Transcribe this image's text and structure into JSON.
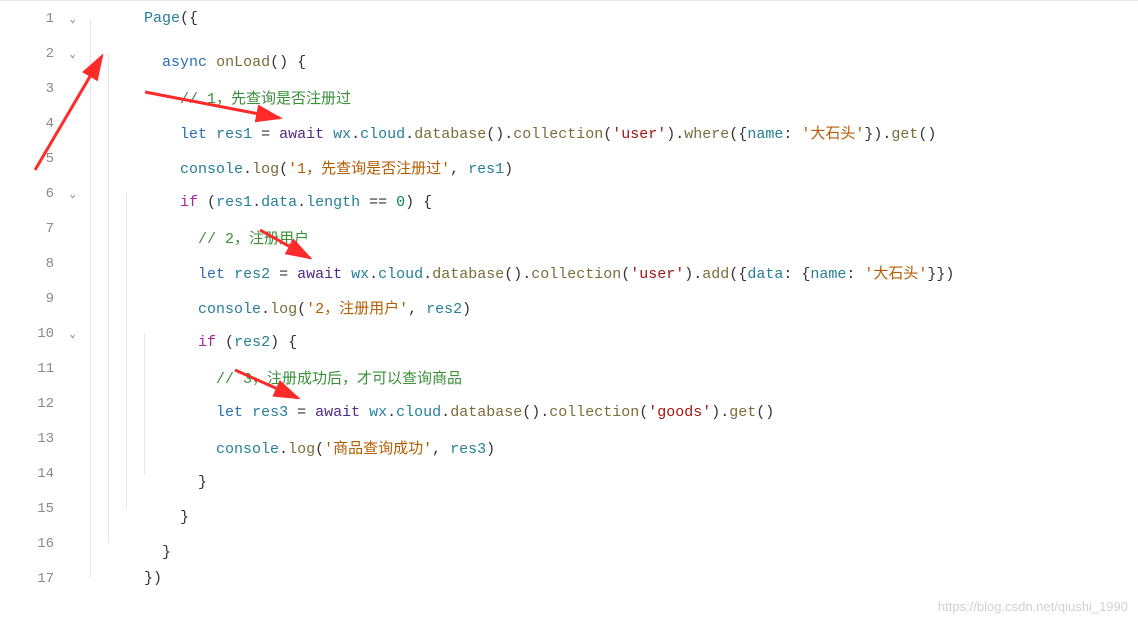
{
  "lines": [
    {
      "num": 1,
      "fold": true
    },
    {
      "num": 2,
      "fold": true
    },
    {
      "num": 3,
      "fold": false
    },
    {
      "num": 4,
      "fold": false
    },
    {
      "num": 5,
      "fold": false
    },
    {
      "num": 6,
      "fold": true
    },
    {
      "num": 7,
      "fold": false
    },
    {
      "num": 8,
      "fold": false
    },
    {
      "num": 9,
      "fold": false
    },
    {
      "num": 10,
      "fold": true
    },
    {
      "num": 11,
      "fold": false
    },
    {
      "num": 12,
      "fold": false
    },
    {
      "num": 13,
      "fold": false
    },
    {
      "num": 14,
      "fold": false
    },
    {
      "num": 15,
      "fold": false
    },
    {
      "num": 16,
      "fold": false
    },
    {
      "num": 17,
      "fold": false
    }
  ],
  "fold_glyph": "⌄",
  "code": {
    "page": "Page",
    "async": "async",
    "onLoad": "onLoad",
    "let": "let",
    "await": "await",
    "if": "if",
    "wx": "wx",
    "cloud": "cloud",
    "database": "database",
    "collection": "collection",
    "where": "where",
    "add": "add",
    "get": "get",
    "console": "console",
    "log": "log",
    "data": "data",
    "length": "length",
    "name": "name",
    "res1": "res1",
    "res2": "res2",
    "res3": "res3",
    "zero": "0",
    "comment1": "// 1，先查询是否注册过",
    "comment2": "// 2，注册用户",
    "comment3": "// 3，注册成功后，才可以查询商品",
    "str_user": "'user'",
    "str_goods": "'goods'",
    "str_stone": "'大石头'",
    "str_log1a": "'1，先查询是否注册过'",
    "str_log2a": "'2，注册用户'",
    "str_log3a": "'商品查询成功'"
  },
  "watermark": "https://blog.csdn.net/qiushi_1990"
}
